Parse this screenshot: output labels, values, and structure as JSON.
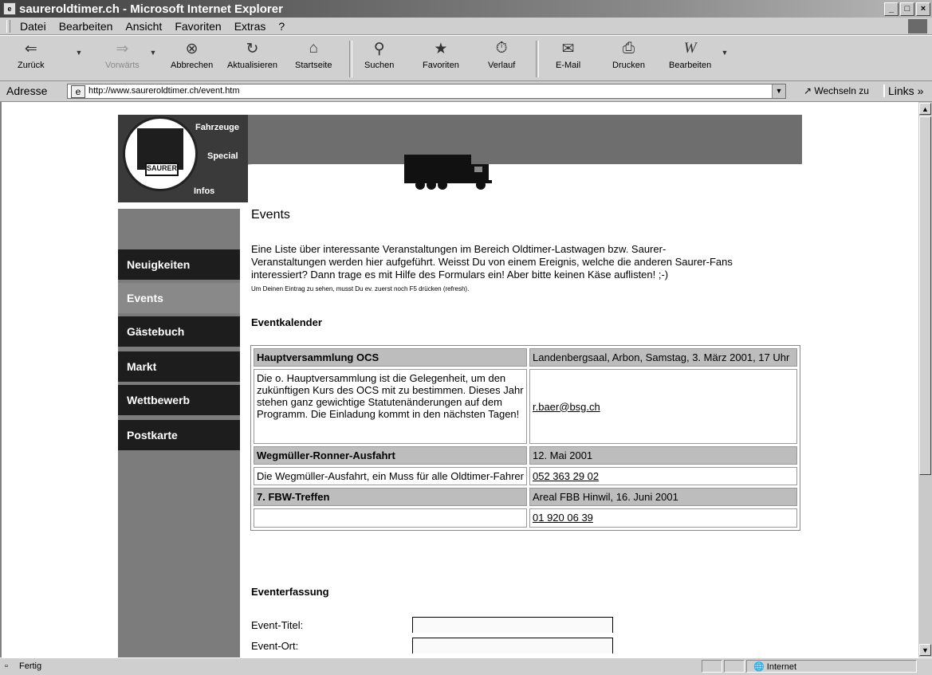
{
  "window": {
    "title": "saureroldtimer.ch - Microsoft Internet Explorer",
    "controls": [
      "_",
      "□",
      "×"
    ]
  },
  "menu": {
    "items": [
      "Datei",
      "Bearbeiten",
      "Ansicht",
      "Favoriten",
      "Extras",
      "?"
    ]
  },
  "toolbar": {
    "back": "Zurück",
    "forward": "Vorwärts",
    "stop": "Abbrechen",
    "refresh": "Aktualisieren",
    "home": "Startseite",
    "search": "Suchen",
    "favorites": "Favoriten",
    "history": "Verlauf",
    "mail": "E-Mail",
    "print": "Drucken",
    "edit": "Bearbeiten"
  },
  "address": {
    "label": "Adresse",
    "url": "http://www.saureroldtimer.ch/event.htm",
    "go": "Wechseln zu",
    "links": "Links"
  },
  "site": {
    "logo_plate": "SAURER",
    "tabs": [
      "Fahrzeuge",
      "Special",
      "Infos"
    ],
    "nav": [
      "Neuigkeiten",
      "Events",
      "Gästebuch",
      "Markt",
      "Wettbewerb",
      "Postkarte"
    ]
  },
  "content": {
    "title": "Events",
    "intro_1": "Eine Liste über interessante Veranstaltungen im Bereich Oldtimer-Lastwagen bzw. Saurer-",
    "intro_2": "Veranstaltungen werden hier aufgeführt. Weisst Du von einem Ereignis, welche die anderen Saurer-Fans",
    "intro_3": "interessiert? Dann trage es mit Hilfe des Formulars ein! Aber bitte keinen Käse auflisten! ;-)",
    "note": "Um Deinen Eintrag zu sehen, musst Du ev. zuerst noch F5 drücken (refresh).",
    "calendar_heading": "Eventkalender",
    "events": [
      {
        "name": "Hauptversammlung OCS",
        "info": "Landenbergsaal, Arbon, Samstag, 3. März 2001, 17 Uhr",
        "description": "Die o. Hauptversammlung ist die Gelegenheit, um den zukünftigen Kurs des OCS mit zu bestimmen. Dieses Jahr stehen ganz gewichtige Statutenänderungen auf dem Programm. Die Einladung kommt in den nächsten Tagen!",
        "contact": "r.baer@bsg.ch"
      },
      {
        "name": "Wegmüller-Ronner-Ausfahrt",
        "info": "12. Mai 2001",
        "description": "Die Wegmüller-Ausfahrt, ein Muss für alle Oldtimer-Fahrer",
        "contact": "052 363 29 02"
      },
      {
        "name": "7. FBW-Treffen",
        "info": "Areal FBB Hinwil, 16. Juni 2001",
        "description": "",
        "contact": "01 920 06 39"
      }
    ],
    "form_heading": "Eventerfassung",
    "form_fields": [
      "Event-Titel:",
      "Event-Ort:"
    ]
  },
  "status": {
    "text": "Fertig",
    "zone": "Internet"
  }
}
